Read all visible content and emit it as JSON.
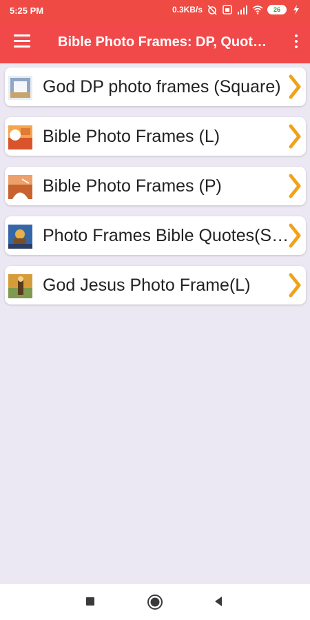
{
  "status_bar": {
    "time": "5:25 PM",
    "speed": "0.3KB/s",
    "battery": "26",
    "icons": [
      "alarm-off-icon",
      "sim-icon",
      "signal-icon",
      "wifi-icon",
      "battery-icon",
      "charging-icon"
    ]
  },
  "app_bar": {
    "title": "Bible Photo Frames: DP, Quotes & Greetings",
    "menu_icon": "hamburger-menu-icon",
    "overflow_icon": "more-vertical-icon"
  },
  "list": {
    "items": [
      {
        "label": "God DP photo frames (Square)",
        "thumb_colors": [
          "#E9EDF2",
          "#8FA6C5",
          "#C7A46C"
        ]
      },
      {
        "label": "Bible Photo Frames (L)",
        "thumb_colors": [
          "#D9542B",
          "#F3A64A",
          "#FFFFFF"
        ]
      },
      {
        "label": "Bible Photo Frames (P)",
        "thumb_colors": [
          "#C8632F",
          "#EDA06A",
          "#FFFFFF"
        ]
      },
      {
        "label": "Photo Frames Bible Quotes(Square)",
        "thumb_colors": [
          "#3566A8",
          "#E5B14A",
          "#7A4F25"
        ]
      },
      {
        "label": "God Jesus Photo Frame(L)",
        "thumb_colors": [
          "#D69C3A",
          "#7E9A4E",
          "#5A3A1E"
        ]
      }
    ],
    "chevron_color": "#F0A21B"
  },
  "nav_bar": {
    "buttons": [
      "recents-square-icon",
      "home-circle-icon",
      "back-triangle-icon"
    ]
  },
  "colors": {
    "accent": "#F1484A",
    "background": "#ECE8F3"
  }
}
